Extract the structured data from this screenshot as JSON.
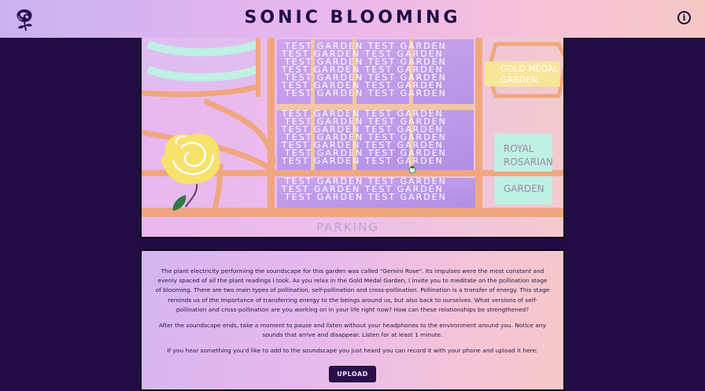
{
  "header": {
    "title": "SONIC BLOOMING",
    "info_label": "i"
  },
  "map": {
    "test_garden_label": "TEST GARDEN",
    "gold_medal_line1": "GOLD MEDAL",
    "gold_medal_line2": "GARDEN",
    "royal_line1": "ROYAL",
    "royal_line2": "ROSARIAN",
    "garden_label": "GARDEN",
    "parking_label": "PARKING"
  },
  "content": {
    "paragraph1": "The plant electricity performing the soundscape for this garden was called \"Gemini Rose\". Its impulses were the most constant and evenly spaced of all the plant readings I took. As you relax in the Gold Medal Garden, I invite you to meditate on the pollination stage of blooming. There are two main types of pollination, self-pollination and cross-pollination. Pollination is a transfer of energy. This stage reminds us of the importance of transferring energy to the beings around us, but also back to ourselves. What versions of self-pollination and cross-pollination are you working on in your life right now? How can these relationships be strengthened?",
    "paragraph2": "After the soundscape ends, take a moment to pause and listen without your headphones to the environment around you. Notice any sounds that arrive and disappear. Listen for at least 1 minute.",
    "paragraph3": "If you hear something you'd like to add to the soundscape you just heard you can record it with your phone and upload it here:",
    "upload_label": "UPLOAD"
  },
  "colors": {
    "background": "#220c43",
    "header_gradient_start": "#c9b3ef",
    "header_gradient_end": "#f6c8c6",
    "map_path": "#f0a77f",
    "mint": "#bff0e4",
    "rose_yellow": "#f7e26b",
    "button_bg": "#2a0f4d"
  }
}
